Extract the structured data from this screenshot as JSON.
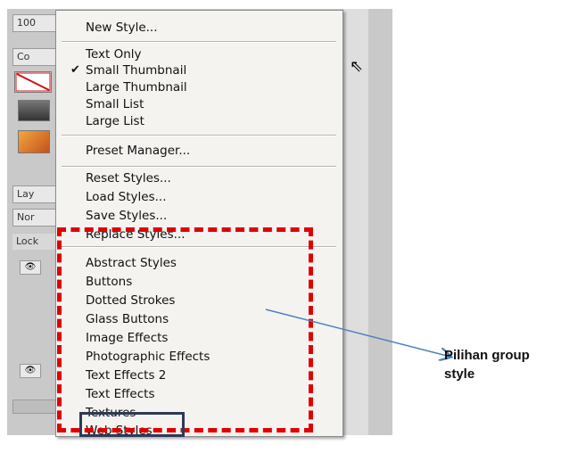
{
  "panel": {
    "fragments": [
      "100",
      "Co",
      "Lay",
      "Nor",
      "Lock"
    ]
  },
  "menu": {
    "sections": [
      {
        "items": [
          {
            "label": "New Style..."
          }
        ]
      },
      {
        "items": [
          {
            "label": "Text Only"
          },
          {
            "label": "Small Thumbnail",
            "checked": true
          },
          {
            "label": "Large Thumbnail"
          },
          {
            "label": "Small List"
          },
          {
            "label": "Large List"
          }
        ]
      },
      {
        "items": [
          {
            "label": "Preset Manager..."
          }
        ]
      },
      {
        "items": [
          {
            "label": "Reset Styles..."
          },
          {
            "label": "Load Styles..."
          },
          {
            "label": "Save Styles..."
          },
          {
            "label": "Replace Styles..."
          }
        ]
      },
      {
        "items": [
          {
            "label": "Abstract Styles"
          },
          {
            "label": "Buttons"
          },
          {
            "label": "Dotted Strokes"
          },
          {
            "label": "Glass Buttons"
          },
          {
            "label": "Image Effects"
          },
          {
            "label": "Photographic Effects"
          },
          {
            "label": "Text Effects 2"
          },
          {
            "label": "Text Effects"
          },
          {
            "label": "Textures"
          },
          {
            "label": "Web Styles"
          }
        ]
      }
    ],
    "check_glyph": "✔"
  },
  "annotation": {
    "label": "Pilihan group style",
    "colors": {
      "dashed_box": "#e00000",
      "highlight_box": "#2b3a57",
      "arrow": "#4f81bd"
    }
  }
}
